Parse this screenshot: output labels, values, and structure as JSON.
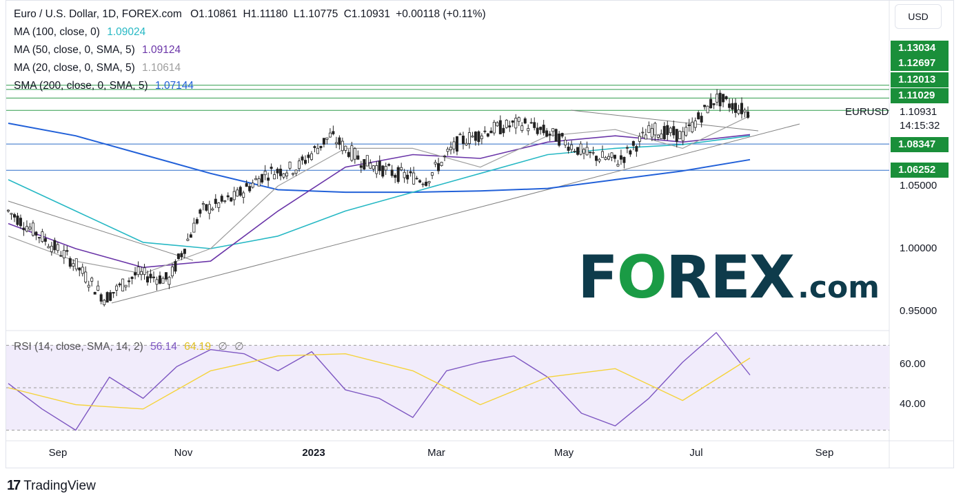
{
  "header": {
    "title": "Euro / U.S. Dollar, 1D, FOREX.com",
    "open_label": "O",
    "open": "1.10861",
    "high_label": "H",
    "high": "1.11180",
    "low_label": "L",
    "low": "1.10775",
    "close_label": "C",
    "close": "1.10931",
    "change": "+0.00118 (+0.11%)",
    "currency_button": "USD"
  },
  "indicators": [
    {
      "label": "MA (100, close, 0)",
      "value": "1.09024",
      "color": "#26b8c4"
    },
    {
      "label": "MA (50, close, 0, SMA, 5)",
      "value": "1.09124",
      "color": "#6a35a8"
    },
    {
      "label": "MA (20, close, 0, SMA, 5)",
      "value": "1.10614",
      "color": "#9e9e9e"
    },
    {
      "label": "SMA (200, close, 0, SMA, 5)",
      "value": "1.07144",
      "color": "#2160d8"
    }
  ],
  "rsi": {
    "label": "RSI (14, close, SMA, 14, 2)",
    "value": "56.14",
    "ma_value": "64.19",
    "extra1": "∅",
    "extra2": "∅",
    "line_color": "#7e57c2",
    "ma_color": "#f5d33a",
    "levels": [
      40.0,
      60.0
    ],
    "band": [
      30,
      70
    ],
    "ymin": 25,
    "ymax": 75
  },
  "price_axis": {
    "tags": [
      "1.13034",
      "1.12697",
      "1.12013",
      "1.11029",
      "1.08347",
      "1.06252"
    ],
    "current_symbol": "EURUSD",
    "current_price": "1.10931",
    "countdown": "14:15:32",
    "ticks": [
      "1.05000",
      "1.00000",
      "0.95000"
    ],
    "rsi_ticks": [
      "60.00",
      "40.00"
    ]
  },
  "time_axis": [
    "Sep",
    "Nov",
    "2023",
    "Mar",
    "May",
    "Jul",
    "Sep"
  ],
  "watermark": {
    "brand": "FOREX",
    "suffix": ".com",
    "color": "#0e3b4b",
    "accent": "#1a9b45"
  },
  "footer": {
    "brand": "TradingView"
  },
  "chart_data": {
    "type": "line",
    "title": "Euro / U.S. Dollar, 1D, FOREX.com",
    "x_unit": "month (2022-08 to 2023-09)",
    "ylim": [
      0.93,
      1.14
    ],
    "y_scale": "linear",
    "horizontal_levels": [
      1.13034,
      1.12697,
      1.12013,
      1.11029,
      1.10931,
      1.08347,
      1.06252
    ],
    "series": [
      {
        "name": "EURUSD",
        "color": "#000000",
        "x": [
          "Aug",
          "Sep",
          "Sep",
          "Sep",
          "Oct",
          "Oct",
          "Nov",
          "Nov",
          "Dec",
          "Dec",
          "Jan",
          "Feb",
          "Feb",
          "Mar",
          "Mar",
          "Apr",
          "Apr",
          "May",
          "May",
          "Jun",
          "Jun",
          "Jul",
          "Jul",
          "Jul"
        ],
        "values": [
          1.03,
          1.01,
          0.99,
          0.96,
          0.98,
          0.975,
          1.03,
          1.04,
          1.06,
          1.065,
          1.09,
          1.07,
          1.06,
          1.055,
          1.085,
          1.095,
          1.1,
          1.09,
          1.075,
          1.07,
          1.095,
          1.09,
          1.12,
          1.109
        ]
      },
      {
        "name": "MA (100, close, 0)",
        "color": "#26b8c4",
        "x": [
          "Aug",
          "Sep",
          "Oct",
          "Nov",
          "Dec",
          "Jan",
          "Feb",
          "Mar",
          "Apr",
          "May",
          "Jun",
          "Jul"
        ],
        "values": [
          1.055,
          1.03,
          1.005,
          1.0,
          1.01,
          1.03,
          1.045,
          1.06,
          1.075,
          1.08,
          1.083,
          1.09
        ]
      },
      {
        "name": "MA (50, close, 0, SMA, 5)",
        "color": "#6a35a8",
        "x": [
          "Aug",
          "Sep",
          "Oct",
          "Nov",
          "Dec",
          "Jan",
          "Feb",
          "Mar",
          "Apr",
          "May",
          "Jun",
          "Jul"
        ],
        "values": [
          1.02,
          1.0,
          0.985,
          0.99,
          1.03,
          1.065,
          1.075,
          1.072,
          1.085,
          1.09,
          1.085,
          1.091
        ]
      },
      {
        "name": "MA (20, close, 0, SMA, 5)",
        "color": "#9e9e9e",
        "x": [
          "Aug",
          "Sep",
          "Oct",
          "Nov",
          "Dec",
          "Jan",
          "Feb",
          "Mar",
          "Apr",
          "May",
          "Jun",
          "Jul"
        ],
        "values": [
          1.01,
          0.99,
          0.98,
          1.0,
          1.05,
          1.08,
          1.08,
          1.065,
          1.09,
          1.095,
          1.08,
          1.106
        ]
      },
      {
        "name": "SMA (200, close, 0, SMA, 5)",
        "color": "#2160d8",
        "x": [
          "Aug",
          "Sep",
          "Oct",
          "Nov",
          "Dec",
          "Jan",
          "Feb",
          "Mar",
          "Apr",
          "May",
          "Jun",
          "Jul"
        ],
        "values": [
          1.1,
          1.09,
          1.075,
          1.06,
          1.047,
          1.045,
          1.045,
          1.046,
          1.048,
          1.055,
          1.062,
          1.071
        ]
      },
      {
        "name": "RSI",
        "color": "#7e57c2",
        "x": [
          "Aug",
          "Sep",
          "Sep",
          "Oct",
          "Oct",
          "Nov",
          "Nov",
          "Dec",
          "Jan",
          "Jan",
          "Feb",
          "Feb",
          "Mar",
          "Mar",
          "Apr",
          "Apr",
          "May",
          "May",
          "Jun",
          "Jun",
          "Jul",
          "Jul",
          "Jul"
        ],
        "values": [
          52,
          40,
          30,
          55,
          45,
          60,
          68,
          66,
          58,
          67,
          49,
          45,
          36,
          58,
          62,
          65,
          55,
          38,
          32,
          45,
          62,
          76,
          56
        ]
      },
      {
        "name": "RSI MA",
        "color": "#f5d33a",
        "x": [
          "Aug",
          "Sep",
          "Oct",
          "Nov",
          "Dec",
          "Jan",
          "Feb",
          "Mar",
          "Apr",
          "May",
          "Jun",
          "Jul"
        ],
        "values": [
          50,
          42,
          40,
          58,
          65,
          66,
          58,
          42,
          55,
          59,
          44,
          64
        ]
      }
    ]
  }
}
